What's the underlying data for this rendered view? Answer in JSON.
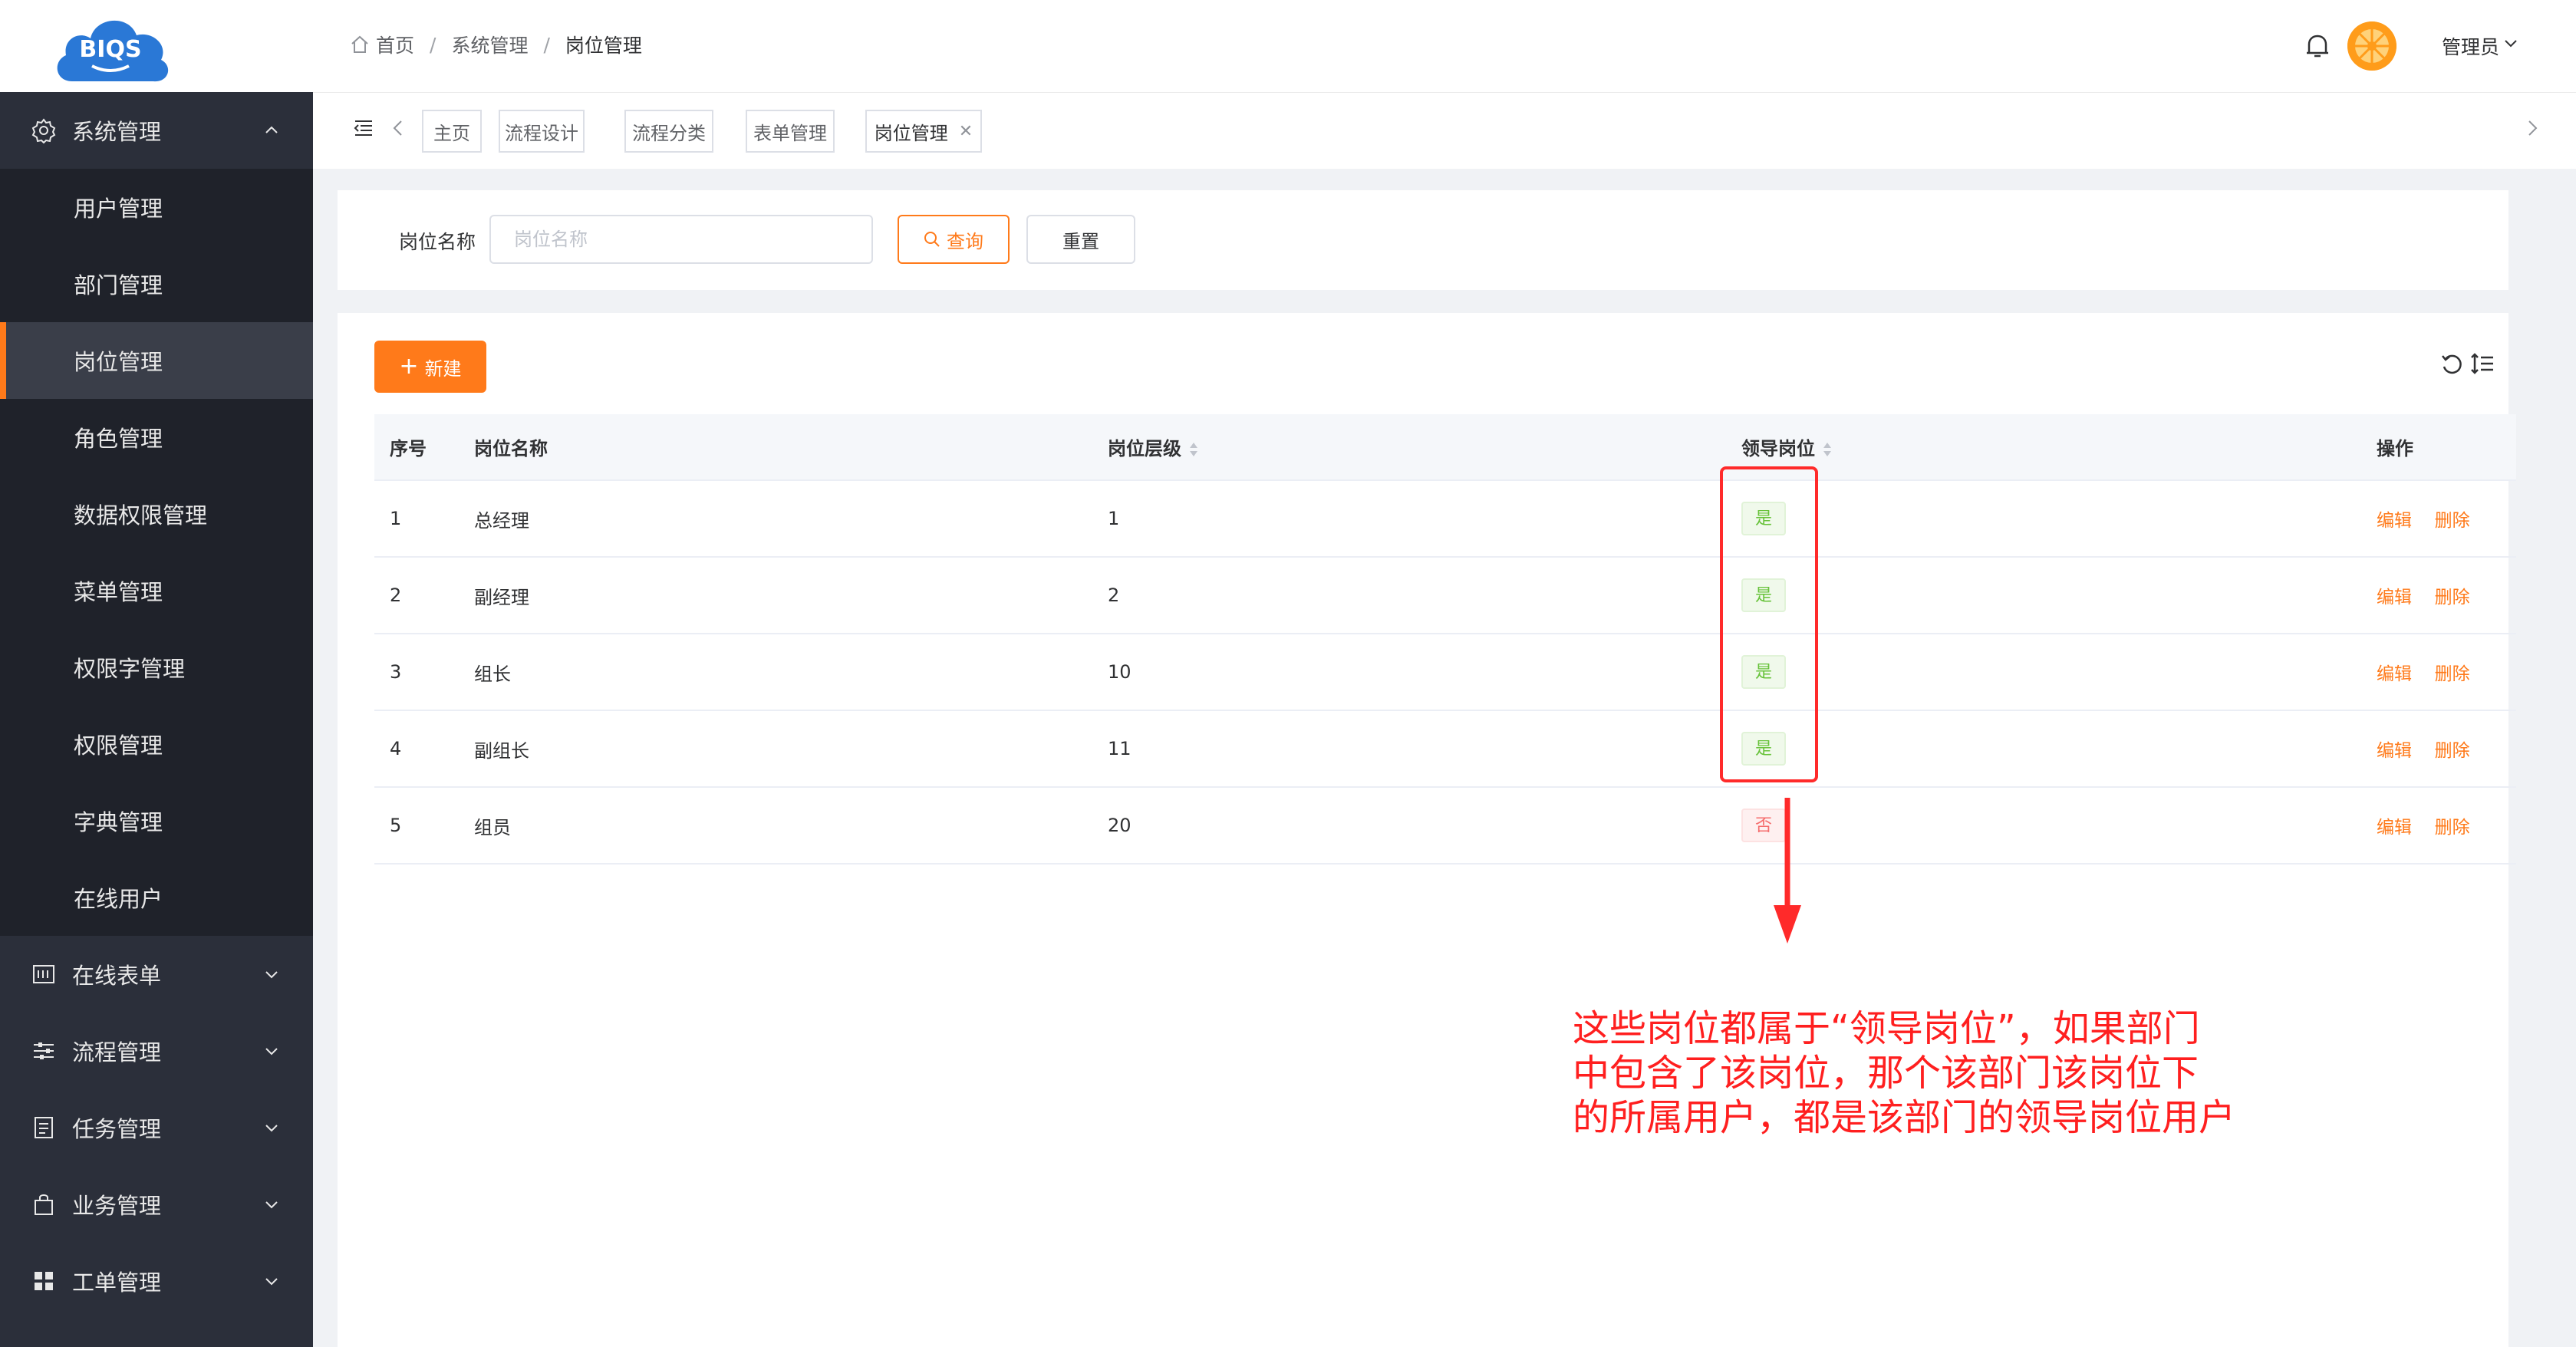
{
  "logo": {
    "text": "BIQS"
  },
  "sidebar": {
    "groups_before": [
      {
        "label": "系统管理",
        "icon": "gear-icon",
        "expanded": true
      }
    ],
    "sub_items": [
      {
        "label": "用户管理",
        "active": false
      },
      {
        "label": "部门管理",
        "active": false
      },
      {
        "label": "岗位管理",
        "active": true
      },
      {
        "label": "角色管理",
        "active": false
      },
      {
        "label": "数据权限管理",
        "active": false
      },
      {
        "label": "菜单管理",
        "active": false
      },
      {
        "label": "权限字管理",
        "active": false
      },
      {
        "label": "权限管理",
        "active": false
      },
      {
        "label": "字典管理",
        "active": false
      },
      {
        "label": "在线用户",
        "active": false
      }
    ],
    "groups_after": [
      {
        "label": "在线表单",
        "icon": "form-icon"
      },
      {
        "label": "流程管理",
        "icon": "sliders-icon"
      },
      {
        "label": "任务管理",
        "icon": "task-icon"
      },
      {
        "label": "业务管理",
        "icon": "bag-icon"
      },
      {
        "label": "工单管理",
        "icon": "grid-icon"
      }
    ]
  },
  "header": {
    "breadcrumb": [
      "首页",
      "系统管理",
      "岗位管理"
    ],
    "user_name": "管理员"
  },
  "tabs": [
    {
      "label": "主页",
      "active": false,
      "closable": false
    },
    {
      "label": "流程设计",
      "active": false,
      "closable": false
    },
    {
      "label": "流程分类",
      "active": false,
      "closable": false
    },
    {
      "label": "表单管理",
      "active": false,
      "closable": false
    },
    {
      "label": "岗位管理",
      "active": true,
      "closable": true
    }
  ],
  "search": {
    "label": "岗位名称",
    "placeholder": "岗位名称",
    "value": "",
    "query_label": "查询",
    "reset_label": "重置"
  },
  "toolbar": {
    "new_label": "新建"
  },
  "table": {
    "columns": [
      "序号",
      "岗位名称",
      "岗位层级",
      "领导岗位",
      "操作"
    ],
    "rows": [
      {
        "index": "1",
        "name": "总经理",
        "level": "1",
        "leader": "是",
        "is_leader": true
      },
      {
        "index": "2",
        "name": "副经理",
        "level": "2",
        "leader": "是",
        "is_leader": true
      },
      {
        "index": "3",
        "name": "组长",
        "level": "10",
        "leader": "是",
        "is_leader": true
      },
      {
        "index": "4",
        "name": "副组长",
        "level": "11",
        "leader": "是",
        "is_leader": true
      },
      {
        "index": "5",
        "name": "组员",
        "level": "20",
        "leader": "否",
        "is_leader": false
      }
    ],
    "edit_label": "编辑",
    "delete_label": "删除"
  },
  "annotation": {
    "lines": [
      "这些岗位都属于“领导岗位”，如果部门",
      "中包含了该岗位，那个该部门该岗位下",
      "的所属用户，都是该部门的领导岗位用户"
    ],
    "color": "#ff1f1f"
  },
  "colors": {
    "accent": "#ff7a1a",
    "sidebar_bg": "#2b2f3a",
    "yes_tag": "#67c23a",
    "no_tag": "#f56c6c"
  }
}
